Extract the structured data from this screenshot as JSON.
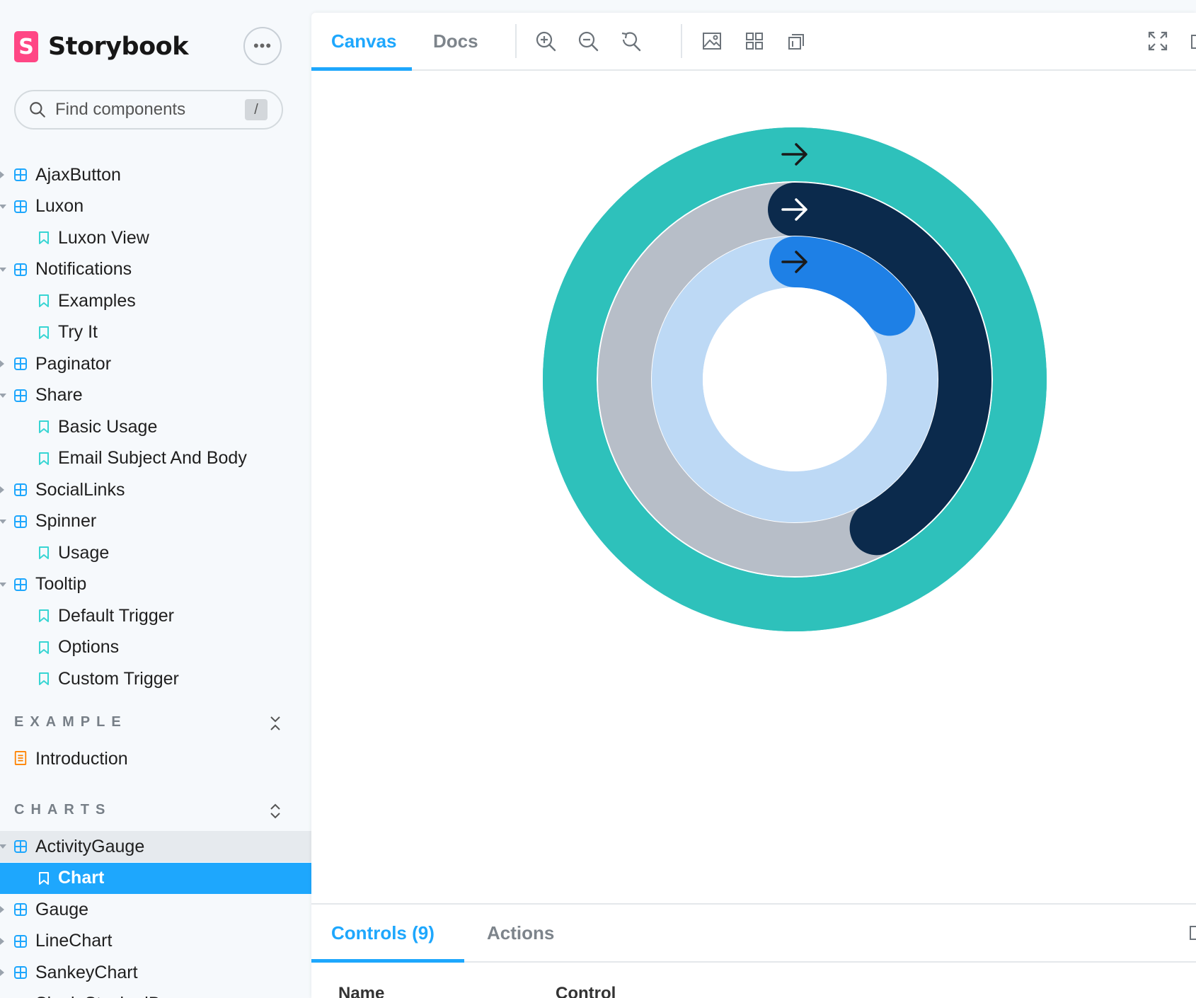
{
  "brand": {
    "logo_letter": "S",
    "name": "Storybook"
  },
  "menu_button": {
    "label": "•••"
  },
  "search": {
    "placeholder": "Find components",
    "shortcut": "/"
  },
  "tree": [
    {
      "label": "AjaxButton",
      "kind": "component",
      "caret": "right"
    },
    {
      "label": "Luxon",
      "kind": "component",
      "caret": "down"
    },
    {
      "label": "Luxon View",
      "kind": "story"
    },
    {
      "label": "Notifications",
      "kind": "component",
      "caret": "down"
    },
    {
      "label": "Examples",
      "kind": "story"
    },
    {
      "label": "Try It",
      "kind": "story"
    },
    {
      "label": "Paginator",
      "kind": "component",
      "caret": "right"
    },
    {
      "label": "Share",
      "kind": "component",
      "caret": "down"
    },
    {
      "label": "Basic Usage",
      "kind": "story"
    },
    {
      "label": "Email Subject And Body",
      "kind": "story"
    },
    {
      "label": "SocialLinks",
      "kind": "component",
      "caret": "right"
    },
    {
      "label": "Spinner",
      "kind": "component",
      "caret": "down"
    },
    {
      "label": "Usage",
      "kind": "story"
    },
    {
      "label": "Tooltip",
      "kind": "component",
      "caret": "down"
    },
    {
      "label": "Default Trigger",
      "kind": "story"
    },
    {
      "label": "Options",
      "kind": "story"
    },
    {
      "label": "Custom Trigger",
      "kind": "story"
    }
  ],
  "sections": [
    {
      "title": "EXAMPLE",
      "toggle_icon": "collapse-icon",
      "items": [
        {
          "label": "Introduction",
          "kind": "doc"
        }
      ]
    },
    {
      "title": "CHARTS",
      "toggle_icon": "expand-icon",
      "items": [
        {
          "label": "ActivityGauge",
          "kind": "component",
          "caret": "down",
          "state": "highlighted"
        },
        {
          "label": "Chart",
          "kind": "story",
          "state": "selected"
        },
        {
          "label": "Gauge",
          "kind": "component",
          "caret": "right"
        },
        {
          "label": "LineChart",
          "kind": "component",
          "caret": "right"
        },
        {
          "label": "SankeyChart",
          "kind": "component",
          "caret": "right"
        },
        {
          "label": "SingleStackedBar",
          "kind": "component",
          "caret": "right"
        }
      ]
    }
  ],
  "toolbar": {
    "tabs": [
      "Canvas",
      "Docs"
    ],
    "active_tab": "Canvas",
    "icons": [
      "zoom-in-icon",
      "zoom-out-icon",
      "zoom-reset-icon",
      "background-icon",
      "grid-icon",
      "outline-icon"
    ],
    "right_icons": [
      "fullscreen-icon"
    ]
  },
  "activity_gauge": {
    "track_colors": [
      "#2ec1bb",
      "#b7bec8",
      "#bdd9f5"
    ],
    "progress_colors": [
      "#2ec1bb",
      "#0b2a4c",
      "#1e80e6"
    ],
    "progress_fractions": [
      1.0,
      0.42,
      0.15
    ],
    "arrow_colors": [
      "#1a1a1a",
      "#ffffff",
      "#1a1a1a"
    ]
  },
  "addons": {
    "tabs": [
      "Controls (9)",
      "Actions"
    ],
    "active_tab": "Controls (9)",
    "columns": [
      "Name",
      "Control"
    ]
  },
  "colors": {
    "accent": "#1ea7fd",
    "brand": "#ff4785",
    "component_icon": "#1ea7fd",
    "story_icon": "#37d5d3",
    "doc_icon": "#ff8300"
  }
}
